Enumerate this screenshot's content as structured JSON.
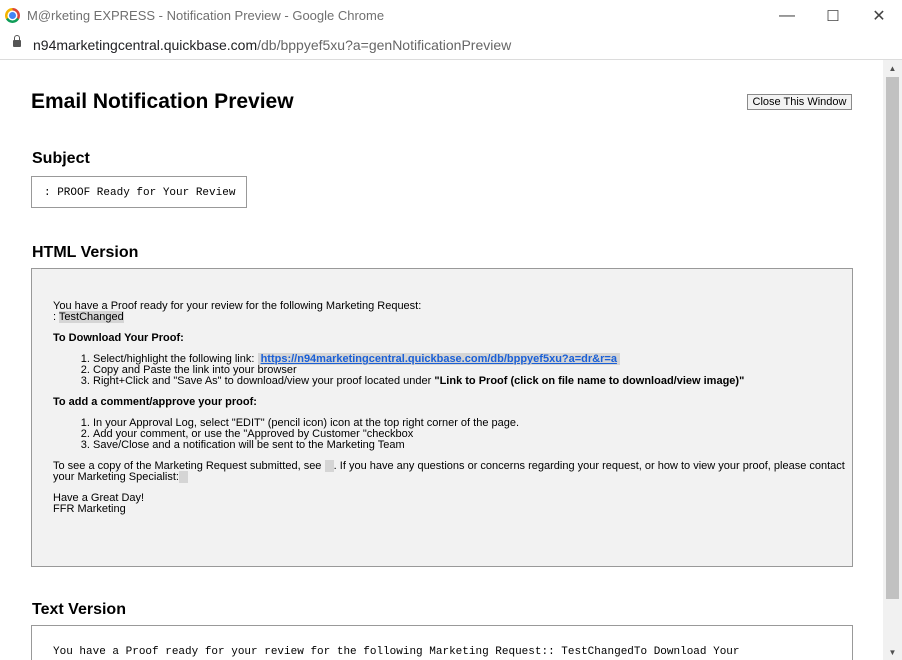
{
  "window": {
    "title": "M@rketing EXPRESS - Notification Preview - Google Chrome",
    "minimize": "—",
    "maximize": "☐",
    "close": "✕"
  },
  "address": {
    "host": "n94marketingcentral.quickbase.com",
    "path": "/db/bppyef5xu?a=genNotificationPreview"
  },
  "page": {
    "title": "Email Notification Preview",
    "close_button": "Close This Window",
    "subject_heading": "Subject",
    "subject_value": ": PROOF Ready for Your Review",
    "html_heading": "HTML Version",
    "text_heading": "Text Version",
    "text_body": "You have a Proof ready for your review for the following Marketing Request:: TestChangedTo Download Your"
  },
  "email": {
    "intro": "You have a Proof ready for your review for the following Marketing Request:",
    "request_prefix": ": ",
    "request_name": "TestChanged",
    "download_heading": "To Download Your Proof:",
    "download_steps": [
      "Select/highlight the following link:",
      "Copy and Paste the link into your browser",
      "Right+Click and \"Save As\" to download/view your proof located under"
    ],
    "download_link": "https://n94marketingcentral.quickbase.com/db/bppyef5xu?a=dr&r=a",
    "proof_location": "\"Link to Proof (click on file name to download/view image)\"",
    "comment_heading": "To add a comment/approve your proof:",
    "comment_steps": [
      "In your Approval Log, select \"EDIT\" (pencil icon) icon at the top right corner of the page.",
      "Add your comment, or use the \"Approved by Customer \"checkbox",
      "Save/Close and a notification will be sent to the Marketing Team"
    ],
    "copy_line_start": "To see a copy of the Marketing Request submitted, see",
    "copy_line_end": ". If you have any questions or concerns regarding your request, or how to view your proof, please contact",
    "specialist_line": "your Marketing Specialist:",
    "sign_off": "Have a Great Day!",
    "sign_name": "FFR Marketing"
  }
}
